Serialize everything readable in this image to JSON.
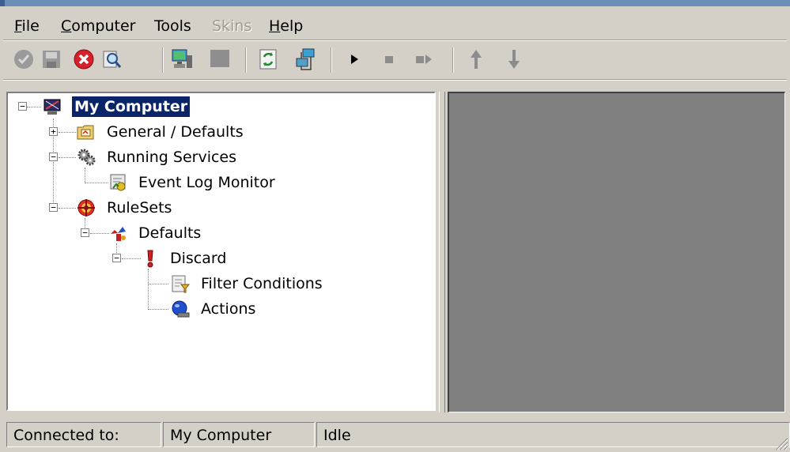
{
  "menu": {
    "file": "File",
    "computer": "Computer",
    "tools": "Tools",
    "skins": "Skins",
    "help": "Help"
  },
  "toolbar": {
    "buttons": [
      {
        "icon": "checkmark-icon",
        "state": "disabled"
      },
      {
        "icon": "save-icon",
        "state": "disabled"
      },
      {
        "icon": "delete-icon",
        "state": "enabled"
      },
      {
        "icon": "find-icon",
        "state": "enabled"
      },
      {
        "icon": "connect-computer-icon",
        "state": "enabled"
      },
      {
        "icon": "disconnect-computer-icon",
        "state": "disabled"
      },
      {
        "icon": "refresh-icon",
        "state": "enabled"
      },
      {
        "icon": "network-config-icon",
        "state": "enabled"
      },
      {
        "icon": "play-icon",
        "state": "enabled"
      },
      {
        "icon": "stop-icon",
        "state": "disabled"
      },
      {
        "icon": "step-icon",
        "state": "disabled"
      },
      {
        "icon": "arrow-up-icon",
        "state": "disabled"
      },
      {
        "icon": "arrow-down-icon",
        "state": "disabled"
      }
    ]
  },
  "tree": {
    "root": "My Computer",
    "general_defaults": "General / Defaults",
    "running_services": "Running Services",
    "event_log_monitor": "Event Log Monitor",
    "rulesets": "RuleSets",
    "defaults": "Defaults",
    "discard": "Discard",
    "filter_conditions": "Filter Conditions",
    "actions": "Actions",
    "expand_symbols": {
      "expanded": "−",
      "collapsed": "+"
    }
  },
  "status": {
    "connected_label": "Connected to:",
    "computer_name": "My Computer",
    "state": "Idle"
  },
  "colors": {
    "window_face": "#d4d0c8",
    "selection": "#0a246a",
    "right_pane": "#808080"
  }
}
